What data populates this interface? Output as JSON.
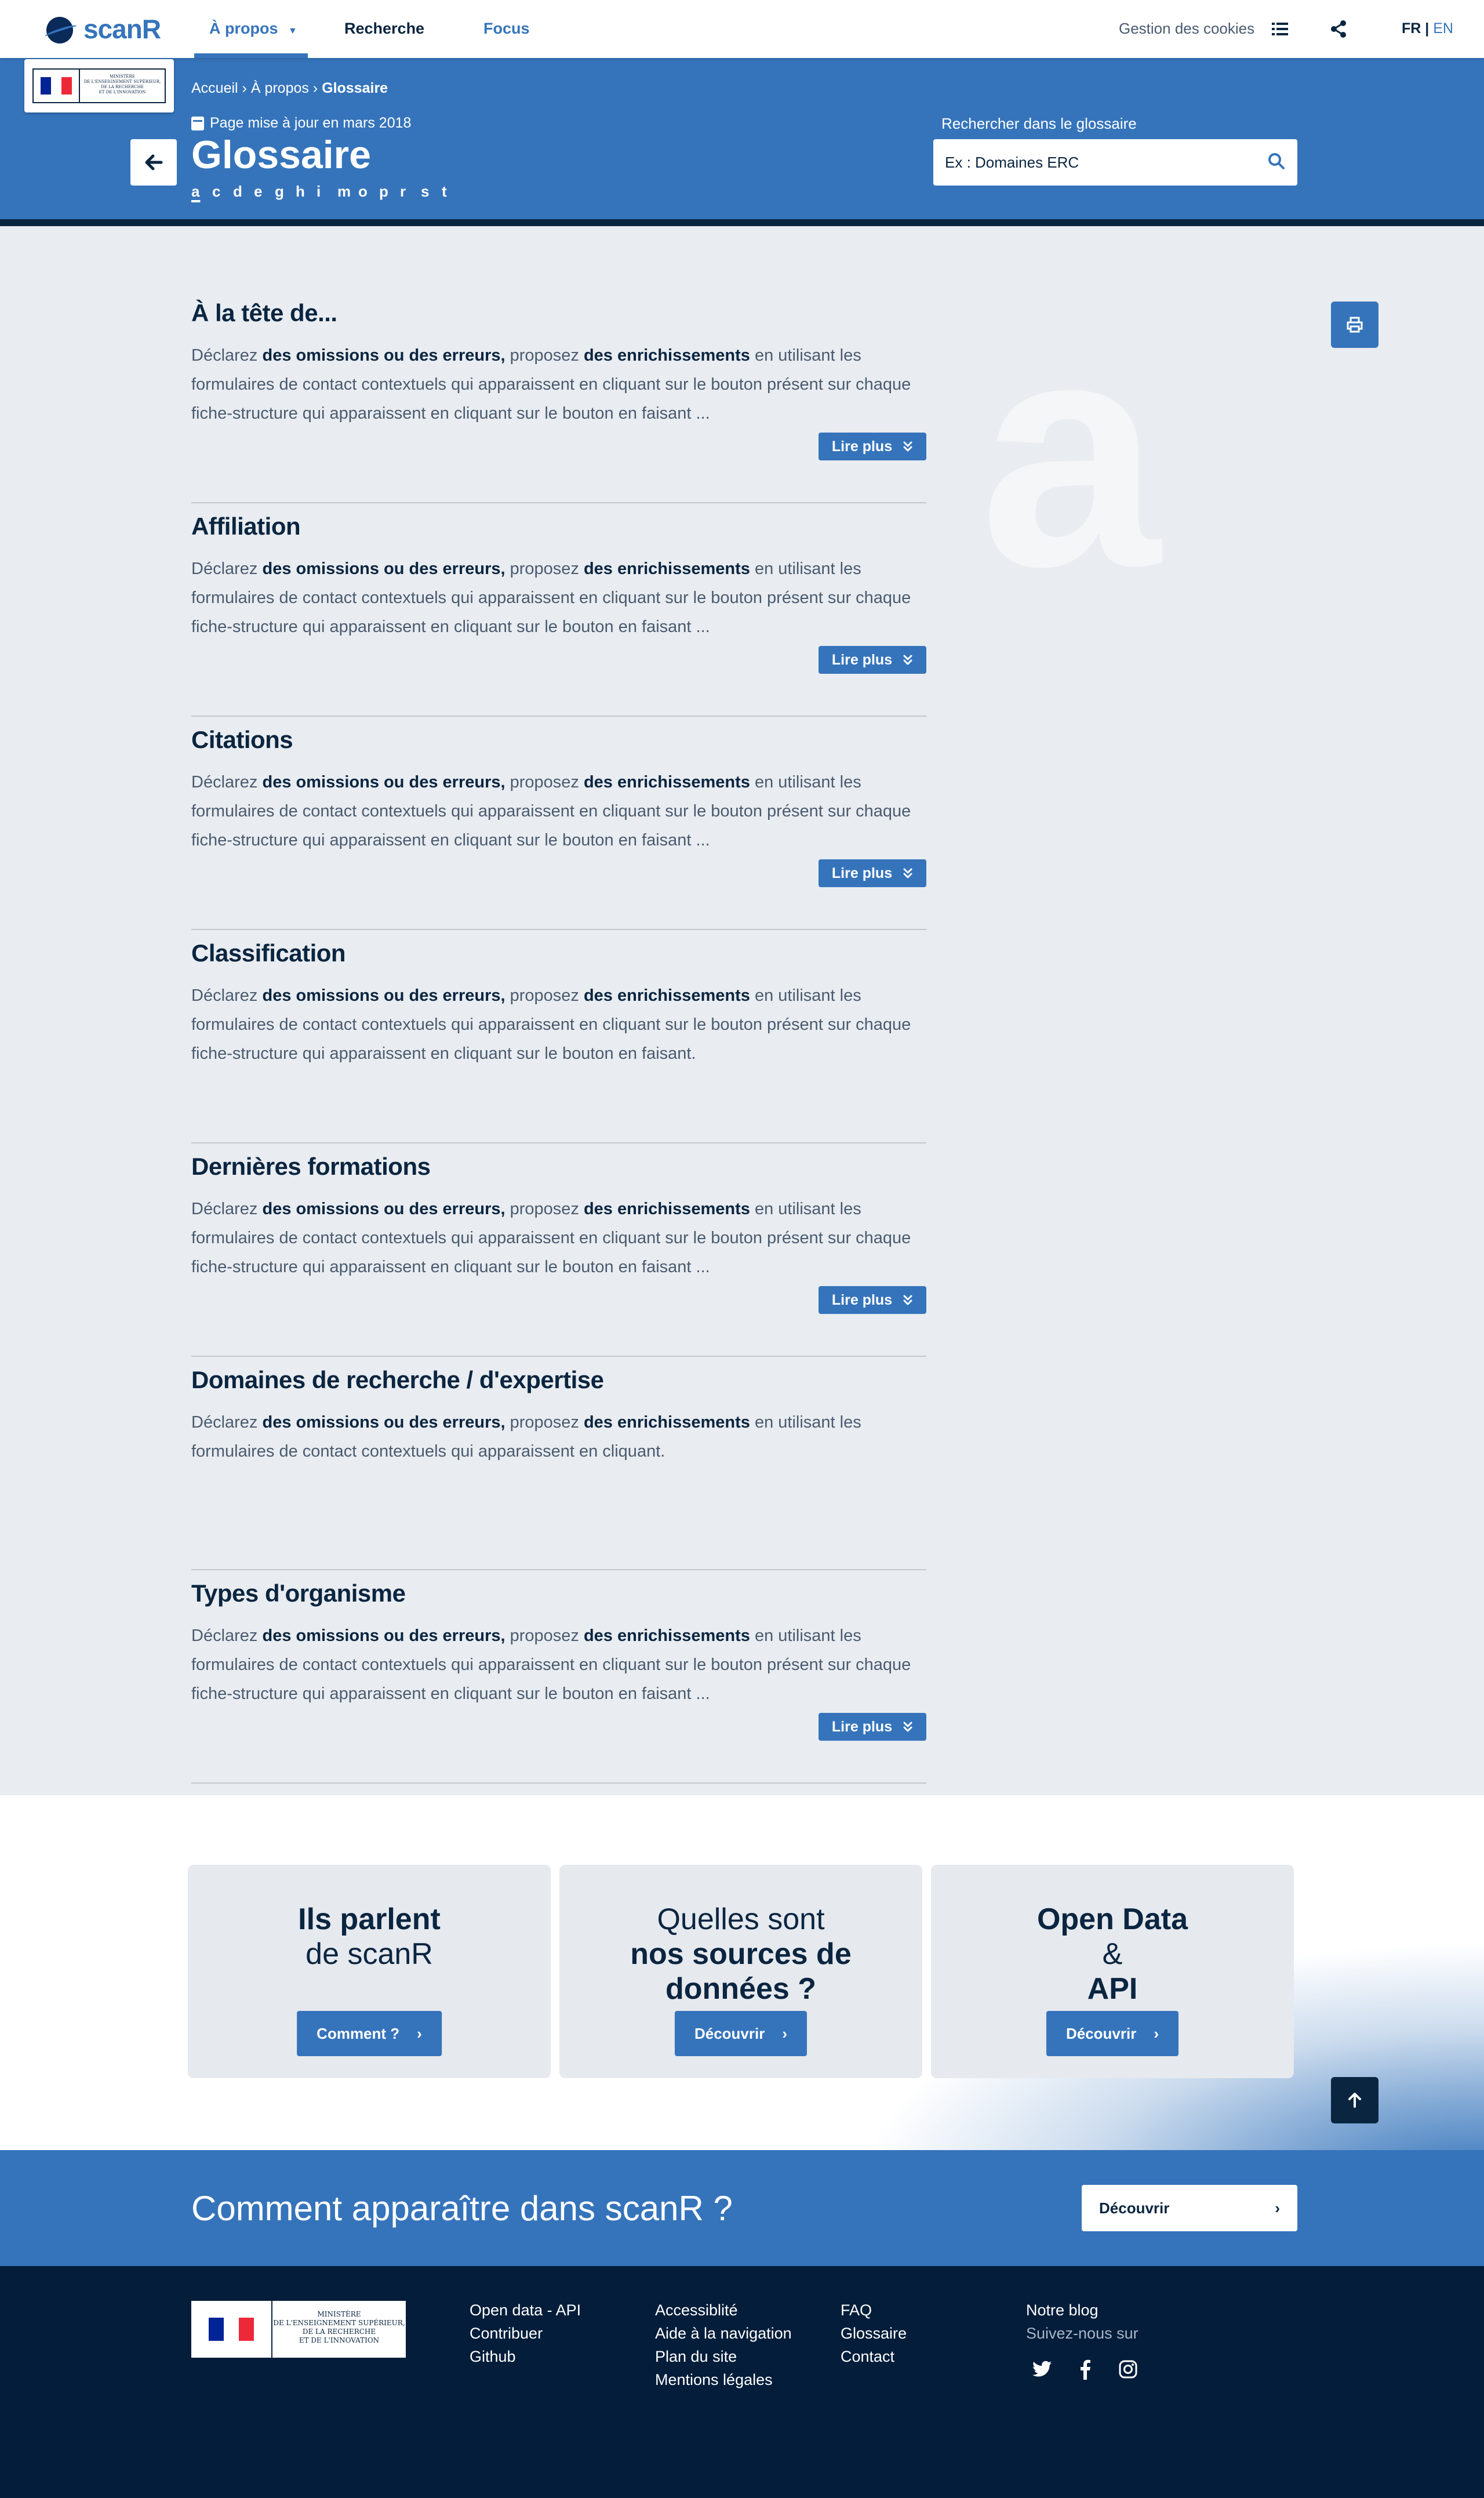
{
  "nav": {
    "logo": "scanR",
    "items": [
      {
        "label": "À propos",
        "active": true
      },
      {
        "label": "Recherche",
        "active": false
      },
      {
        "label": "Focus",
        "active": false
      }
    ],
    "cookies": "Gestion des cookies",
    "lang_fr": "FR",
    "lang_sep": "|",
    "lang_en": "EN"
  },
  "ministry": {
    "line1": "MINISTÈRE",
    "line2": "DE L'ENSEIGNEMENT SUPÉRIEUR,",
    "line3": "DE LA RECHERCHE",
    "line4": "ET DE L'INNOVATION"
  },
  "header": {
    "breadcrumb_home": "Accueil",
    "breadcrumb_sep": "›",
    "breadcrumb_about": "À propos",
    "breadcrumb_current": "Glossaire",
    "updated": "Page mise à jour en mars 2018",
    "title": "Glossaire",
    "letters": [
      "a",
      "c",
      "d",
      "e",
      "g",
      "h",
      "i",
      "m",
      "o",
      "p",
      "r",
      "s",
      "t"
    ],
    "current_letter": "a",
    "search_label": "Rechercher dans le glossaire",
    "search_placeholder": "Ex : Domaines ERC"
  },
  "entries": [
    {
      "title": "À la tête de...",
      "pre": "Déclarez ",
      "b1": "des omissions ou des erreurs,",
      "mid": " proposez ",
      "b2": "des enrichissements",
      "post": " en utilisant les formulaires de contact contextuels qui apparaissent en cliquant sur le bouton présent sur chaque fiche-structure qui apparaissent en cliquant sur le bouton en faisant ...",
      "more": "Lire plus"
    },
    {
      "title": "Affiliation",
      "pre": "Déclarez ",
      "b1": "des omissions ou des erreurs,",
      "mid": " proposez ",
      "b2": "des enrichissements",
      "post": " en utilisant les formulaires de contact contextuels qui apparaissent en cliquant sur le bouton présent sur chaque fiche-structure qui apparaissent en cliquant sur le bouton en faisant ...",
      "more": "Lire plus"
    },
    {
      "title": "Citations",
      "pre": "Déclarez ",
      "b1": "des omissions ou des erreurs,",
      "mid": " proposez ",
      "b2": "des enrichissements",
      "post": " en utilisant les formulaires de contact contextuels qui apparaissent en cliquant sur le bouton présent sur chaque fiche-structure qui apparaissent en cliquant sur le bouton en faisant ...",
      "more": "Lire plus"
    },
    {
      "title": "Classification",
      "pre": "Déclarez ",
      "b1": "des omissions ou des erreurs,",
      "mid": " proposez ",
      "b2": "des enrichissements",
      "post": " en utilisant les formulaires de contact contextuels qui apparaissent en cliquant sur le bouton présent sur chaque fiche-structure qui apparaissent en cliquant sur le bouton en faisant.",
      "more": ""
    },
    {
      "title": "Dernières formations",
      "pre": "Déclarez ",
      "b1": "des omissions ou des erreurs,",
      "mid": " proposez ",
      "b2": "des enrichissements",
      "post": " en utilisant les formulaires de contact contextuels qui apparaissent en cliquant sur le bouton présent sur chaque fiche-structure qui apparaissent en cliquant sur le bouton en faisant ...",
      "more": "Lire plus"
    },
    {
      "title": "Domaines de recherche / d'expertise",
      "pre": "Déclarez ",
      "b1": "des omissions ou des erreurs,",
      "mid": " proposez ",
      "b2": "des enrichissements",
      "post": " en utilisant les formulaires de contact contextuels qui apparaissent en cliquant.",
      "more": ""
    },
    {
      "title": "Types d'organisme",
      "pre": "Déclarez ",
      "b1": "des omissions ou des erreurs,",
      "mid": " proposez ",
      "b2": "des enrichissements",
      "post": " en utilisant les formulaires de contact contextuels qui apparaissent en cliquant sur le bouton présent sur chaque fiche-structure qui apparaissent en cliquant sur le bouton en faisant ...",
      "more": "Lire plus"
    }
  ],
  "big_letter": "a",
  "cards": [
    {
      "line1": "Ils parlent",
      "line2": "de scanR",
      "line3": "",
      "button": "Comment ?"
    },
    {
      "line1": "Quelles sont",
      "line2": "nos sources de",
      "line3": "données ?",
      "button": "Découvrir"
    },
    {
      "line1": "Open Data",
      "line2": "&",
      "line3": "API",
      "button": "Découvrir"
    }
  ],
  "cta": {
    "text": "Comment apparaître dans scanR ?",
    "button": "Découvrir"
  },
  "footer": {
    "col1": [
      "Open data - API",
      "Contribuer",
      "Github"
    ],
    "col2": [
      "Accessiblité",
      "Aide à la navigation",
      "Plan du site",
      "Mentions légales"
    ],
    "col3": [
      "FAQ",
      "Glossaire",
      "Contact"
    ],
    "blog": "Notre blog",
    "follow": "Suivez-nous sur"
  },
  "colors": {
    "primary": "#3574bb",
    "navy": "#0a2540",
    "footer": "#031d3a",
    "background": "#e9ecf0"
  }
}
